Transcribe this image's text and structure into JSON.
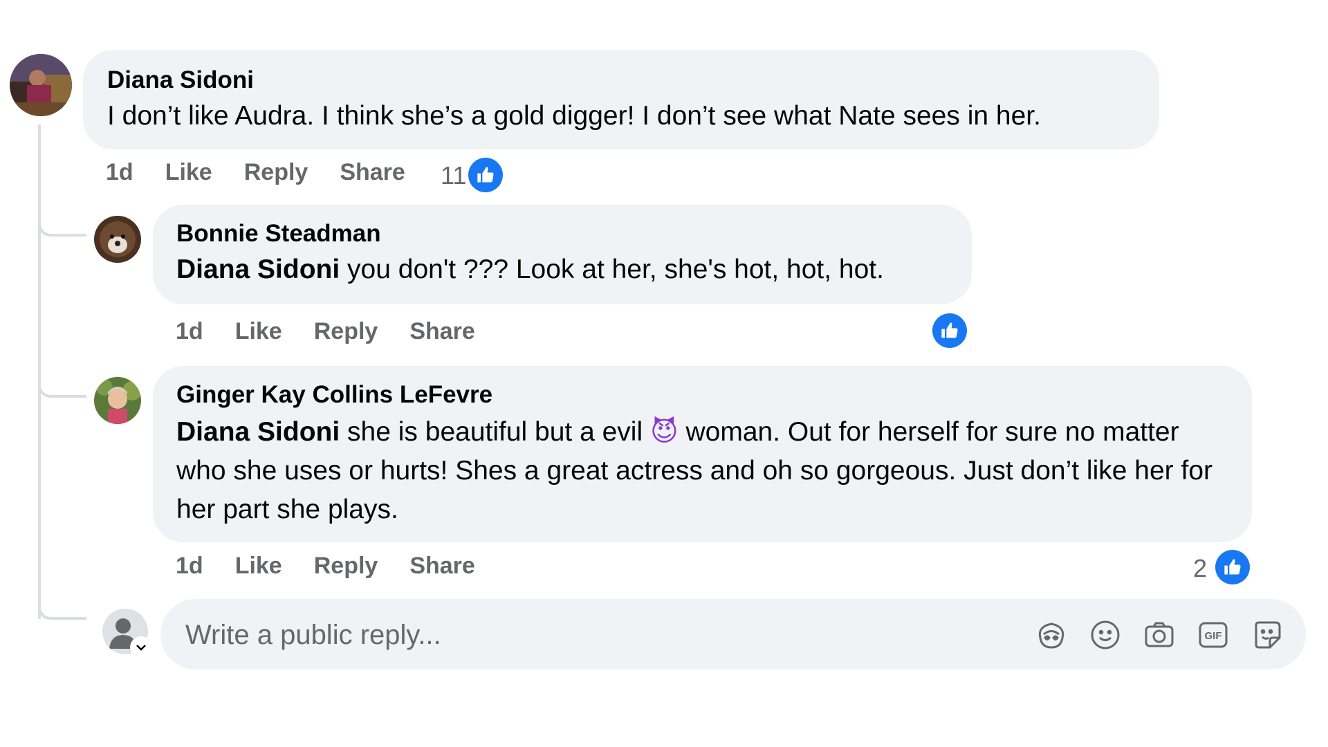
{
  "comments": [
    {
      "author": "Diana Sidoni",
      "mention": "",
      "text": "I don’t like Audra. I think she’s a gold digger! I don’t see what Nate sees in her.",
      "time": "1d",
      "like_label": "Like",
      "reply_label": "Reply",
      "share_label": "Share",
      "reaction_count": "11"
    },
    {
      "author": "Bonnie Steadman",
      "mention": "Diana Sidoni",
      "text": " you don't ??? Look at her, she's hot, hot, hot.",
      "time": "1d",
      "like_label": "Like",
      "reply_label": "Reply",
      "share_label": "Share",
      "reaction_count": ""
    },
    {
      "author": "Ginger Kay Collins LeFevre",
      "mention": "Diana Sidoni",
      "text_before_emoji": " she is beautiful but a evil ",
      "emoji": "😈",
      "text_after_emoji": " woman. Out for herself for sure no matter who she uses or hurts! Shes a great actress and oh so gorgeous. Just don’t like her for her part she plays.",
      "time": "1d",
      "like_label": "Like",
      "reply_label": "Reply",
      "share_label": "Share",
      "reaction_count": "2"
    }
  ],
  "reply_box": {
    "placeholder": "Write a public reply...",
    "icons": [
      "avatar-sticker-icon",
      "emoji-icon",
      "camera-icon",
      "gif-icon",
      "sticker-icon"
    ]
  },
  "colors": {
    "bubble_bg": "#f0f2f5",
    "like_blue": "#1877f2",
    "secondary_text": "#65676b",
    "thread_line": "#dadde1"
  }
}
